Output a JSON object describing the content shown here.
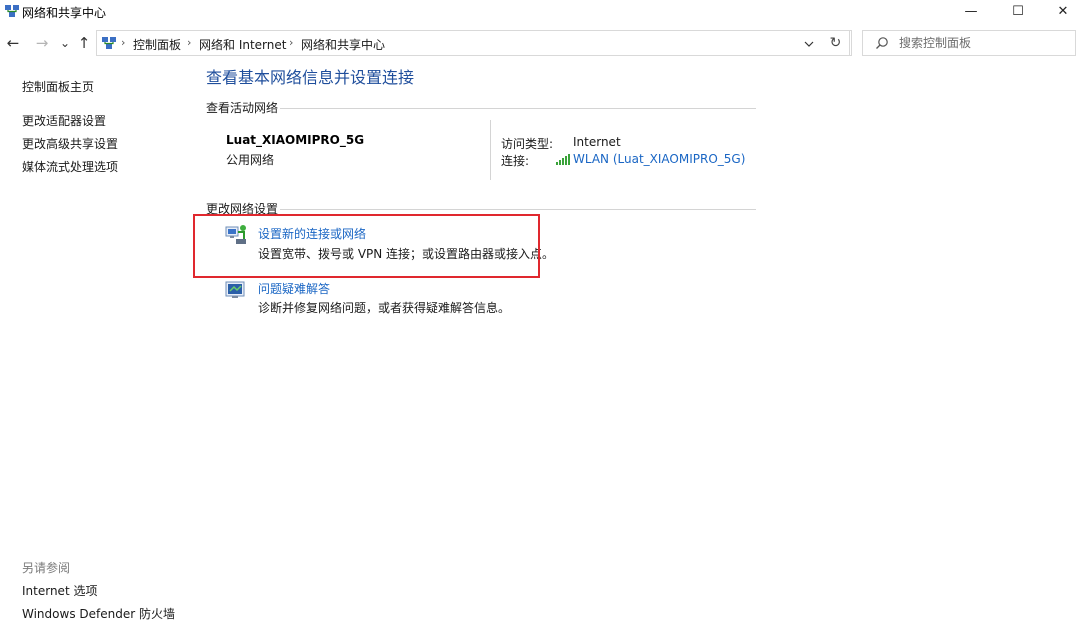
{
  "window": {
    "title": "网络和共享中心",
    "minimize_glyph": "—",
    "maximize_glyph": "☐",
    "close_glyph": "✕"
  },
  "nav": {
    "back_glyph": "←",
    "forward_glyph": "→",
    "recent_glyph": "⌄",
    "up_glyph": "↑",
    "refresh_glyph": "↻"
  },
  "breadcrumb": {
    "items": [
      "控制面板",
      "网络和 Internet",
      "网络和共享中心"
    ],
    "separator": "›"
  },
  "search": {
    "placeholder": "搜索控制面板",
    "value": ""
  },
  "sidebar": {
    "items": [
      {
        "label": "控制面板主页"
      },
      {
        "label": "更改适配器设置"
      },
      {
        "label": "更改高级共享设置"
      },
      {
        "label": "媒体流式处理选项"
      }
    ],
    "see_also_title": "另请参阅",
    "see_also_items": [
      {
        "label": "Internet 选项"
      },
      {
        "label": "Windows Defender 防火墙"
      }
    ]
  },
  "main": {
    "title": "查看基本网络信息并设置连接",
    "active_networks_header": "查看活动网络",
    "network": {
      "name": "Luat_XIAOMIPRO_5G",
      "category": "公用网络",
      "access_type_label": "访问类型:",
      "access_type_value": "Internet",
      "connection_label": "连接:",
      "connection_value": "WLAN (Luat_XIAOMIPRO_5G)"
    },
    "change_settings_header": "更改网络设置",
    "tasks": [
      {
        "link": "设置新的连接或网络",
        "description": "设置宽带、拨号或 VPN 连接；或设置路由器或接入点。",
        "icon": "network-setup-icon"
      },
      {
        "link": "问题疑难解答",
        "description": "诊断并修复网络问题，或者获得疑难解答信息。",
        "icon": "troubleshoot-icon"
      }
    ]
  },
  "colors": {
    "link": "#1a66c4",
    "title": "#1f4e9c",
    "highlight": "#e0282e",
    "divider": "#d4d4d4",
    "wifi": "#3aa33a"
  }
}
